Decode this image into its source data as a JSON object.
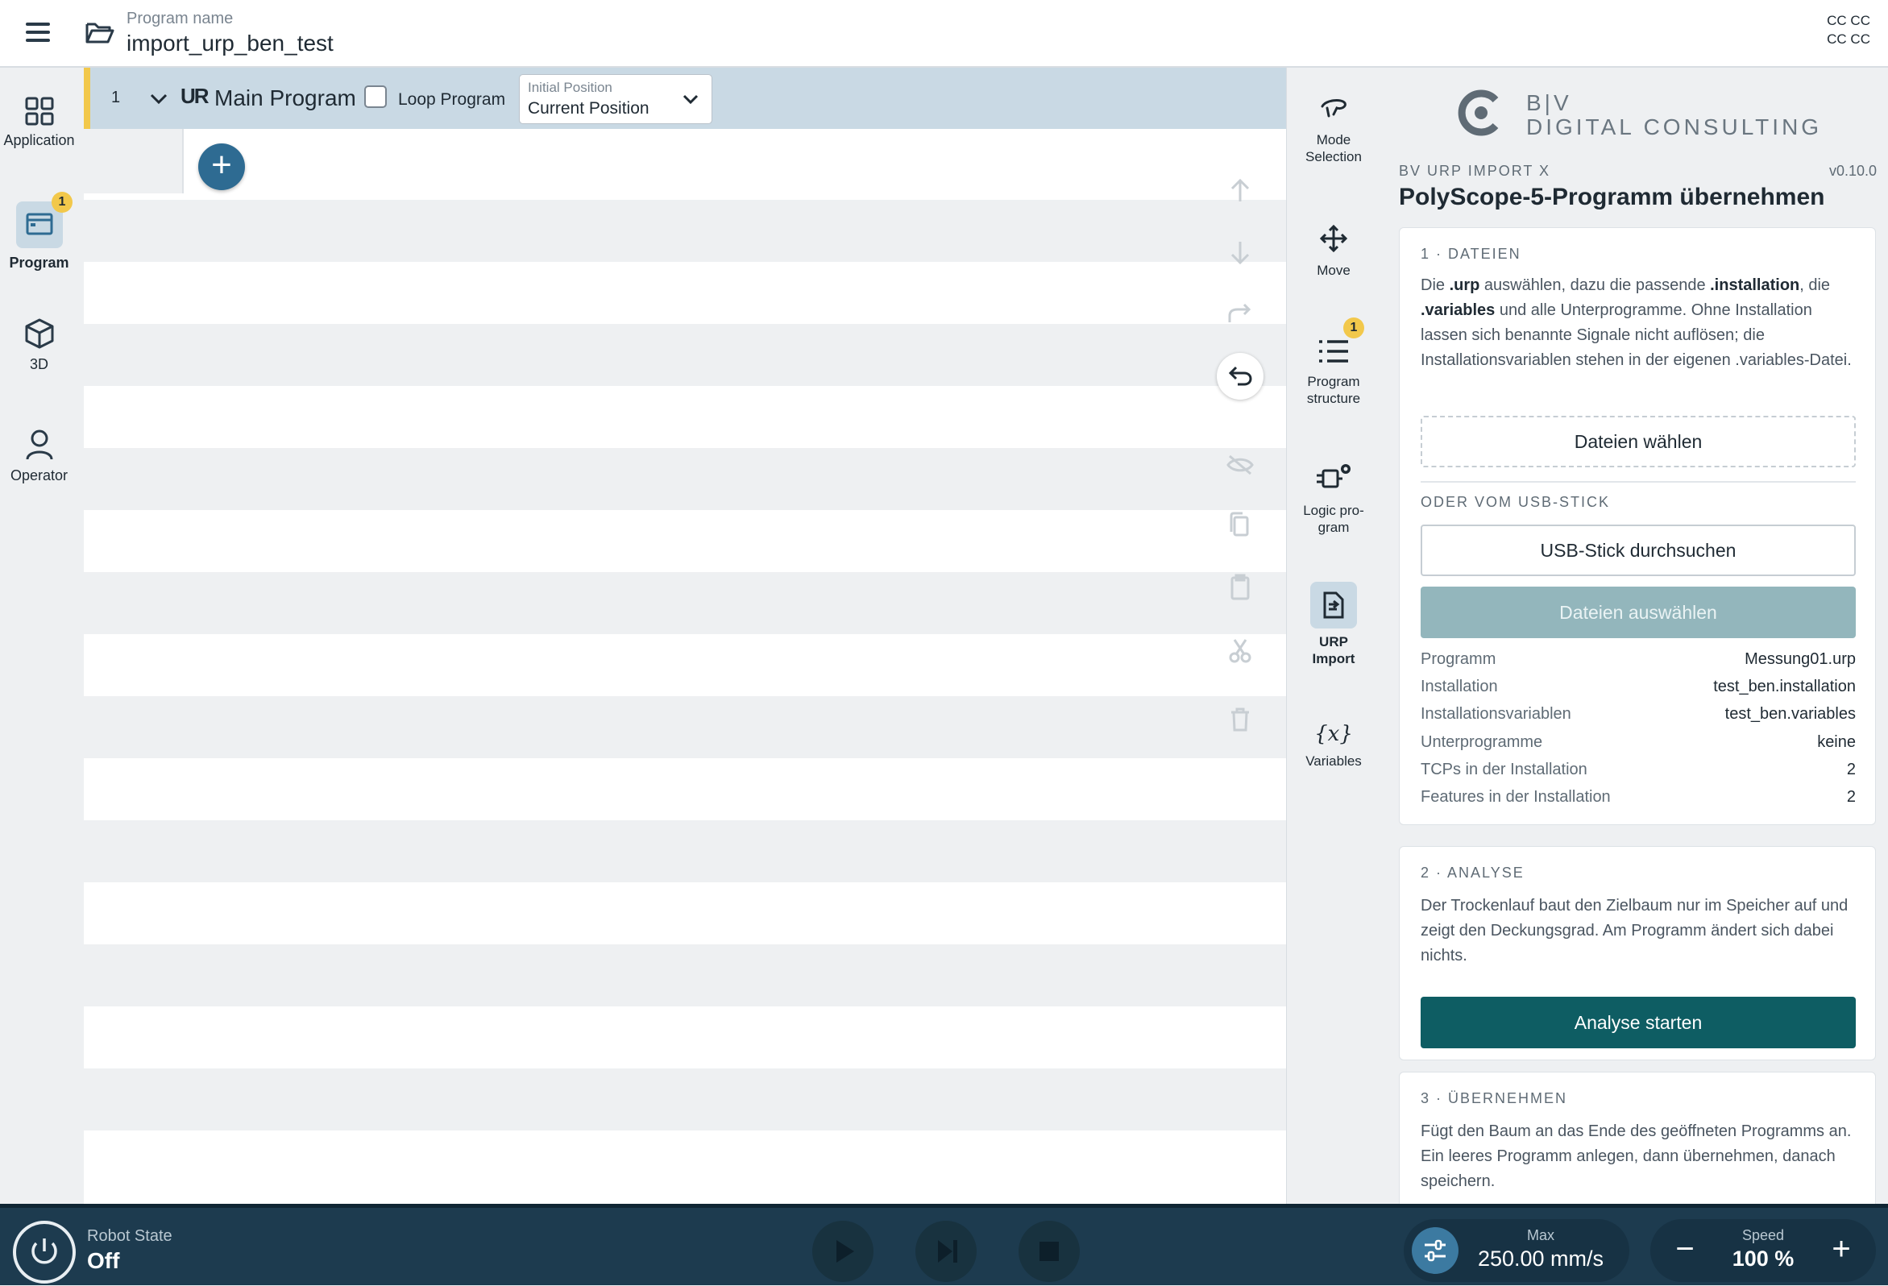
{
  "header": {
    "program_label": "Program name",
    "program_name": "import_urp_ben_test",
    "cc_line1": "CC CC",
    "cc_line2": "CC CC"
  },
  "leftnav": {
    "items": [
      {
        "label": "Application",
        "icon": "grid-icon"
      },
      {
        "label": "Program",
        "icon": "program-window-icon",
        "badge": "1",
        "active": true
      },
      {
        "label": "3D",
        "icon": "cube-icon"
      },
      {
        "label": "Operator",
        "icon": "person-icon"
      }
    ]
  },
  "program": {
    "line_number": "1",
    "ur_logo": "UR",
    "title": "Main Program",
    "loop_label": "Loop Program",
    "loop_checked": false,
    "initial_position_label": "Initial Position",
    "initial_position_value": "Current Position",
    "add_symbol": "+"
  },
  "rail": {
    "items": [
      {
        "label_line1": "Mode",
        "label_line2": "Selection",
        "icon": "hand-icon"
      },
      {
        "label_line1": "Move",
        "label_line2": "",
        "icon": "move-arrows-icon"
      },
      {
        "label_line1": "Program",
        "label_line2": "structure",
        "icon": "list-icon",
        "badge": "1"
      },
      {
        "label_line1": "Logic pro-",
        "label_line2": "gram",
        "icon": "logic-icon"
      },
      {
        "label_line1": "URP",
        "label_line2": "Import",
        "icon": "import-document-icon",
        "active": true
      },
      {
        "label_line1": "Variables",
        "label_line2": "",
        "icon": "variables-icon",
        "glyph": "{x}"
      }
    ]
  },
  "panel": {
    "brand_line1": "B|V",
    "brand_line2": "DIGITAL CONSULTING",
    "plugin_name": "BV URP IMPORT X",
    "version": "v0.10.0",
    "title": "PolyScope-5-Programm übernehmen",
    "section1": {
      "title": "1 · DATEIEN",
      "text_a": "Die ",
      "text_b": ".urp",
      "text_c": " auswählen, dazu die passende ",
      "text_d": ".installation",
      "text_e": ", die ",
      "text_f": ".variables",
      "text_g": " und alle Unterprogramme. Ohne Installation lassen sich benannte Signale nicht auflösen; die Installationsvariablen stehen in der eigenen .variables-Datei.",
      "choose_button": "Dateien wählen",
      "usb_label": "ODER VOM USB-STICK",
      "usb_button": "USB-Stick durchsuchen",
      "select_button": "Dateien auswählen",
      "rows": [
        {
          "key": "Programm",
          "value": "Messung01.urp"
        },
        {
          "key": "Installation",
          "value": "test_ben.installation"
        },
        {
          "key": "Installationsvariablen",
          "value": "test_ben.variables"
        },
        {
          "key": "Unterprogramme",
          "value": "keine"
        },
        {
          "key": "TCPs in der Installation",
          "value": "2"
        },
        {
          "key": "Features in der Installation",
          "value": "2"
        }
      ]
    },
    "section2": {
      "title": "2 · ANALYSE",
      "text": "Der Trockenlauf baut den Zielbaum nur im Speicher auf und zeigt den Deckungsgrad. Am Programm ändert sich dabei nichts.",
      "button": "Analyse starten"
    },
    "section3": {
      "title": "3 · ÜBERNEHMEN",
      "text": "Fügt den Baum an das Ende des geöffneten Programms an. Ein leeres Programm anlegen, dann übernehmen, danach speichern."
    }
  },
  "bottombar": {
    "robot_state_label": "Robot State",
    "robot_state_value": "Off",
    "max_label": "Max",
    "max_value": "250.00 mm/s",
    "speed_label": "Speed",
    "speed_value": "100 %",
    "minus": "−",
    "plus": "+"
  },
  "colors": {
    "accent_yellow": "#f2c84b",
    "primary_teal": "#0e5d63",
    "disabled_teal": "#93b6bc",
    "bottom_bar": "#1d3b4f",
    "selected_row": "#c9d9e4"
  }
}
